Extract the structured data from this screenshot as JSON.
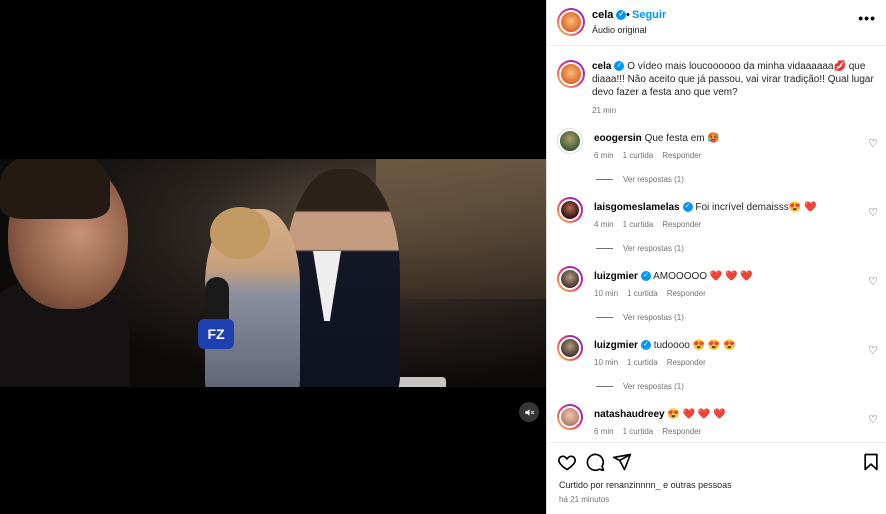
{
  "header": {
    "username": "cela",
    "follow_label": "Seguir",
    "dot": "•",
    "audio": "Áudio original",
    "more": "•••"
  },
  "video": {
    "mic_label": "FZ"
  },
  "caption": {
    "username": "cela",
    "text": "O vídeo mais loucoooooo da minha vidaaaaaa💋 que diaaa!!! Não aceito que já passou, vai virar tradição!! Qual lugar devo fazer a festa ano que vem?",
    "time": "21 min"
  },
  "comments": [
    {
      "username": "eoogersin",
      "text": "Que festa em 🥵",
      "time": "6 min",
      "likes": "1 curtida",
      "reply": "Responder",
      "view_replies": "Ver respostas (1)",
      "verified": false
    },
    {
      "username": "laisgomeslamelas",
      "text": "Foi incrível demaisss😍 ❤️",
      "time": "4 min",
      "likes": "1 curtida",
      "reply": "Responder",
      "view_replies": "Ver respostas (1)",
      "verified": true
    },
    {
      "username": "luizgmier",
      "text": "AMOOOOO ❤️ ❤️ ❤️",
      "time": "10 min",
      "likes": "1 curtida",
      "reply": "Responder",
      "view_replies": "Ver respostas (1)",
      "verified": true
    },
    {
      "username": "luizgmier",
      "text": "tudoooo 😍 😍 😍",
      "time": "10 min",
      "likes": "1 curtida",
      "reply": "Responder",
      "view_replies": "Ver respostas (1)",
      "verified": true
    },
    {
      "username": "natashaudreey",
      "text": "😍 ❤️ ❤️ ❤️",
      "time": "6 min",
      "likes": "1 curtida",
      "reply": "Responder",
      "verified": false
    }
  ],
  "footer": {
    "liked_by": "Curtido por renanzinnnn_ e outras pessoas",
    "time": "há 21 minutos"
  },
  "colors": {
    "accent": "#0095f6",
    "muted": "#737373",
    "text": "#262626"
  }
}
